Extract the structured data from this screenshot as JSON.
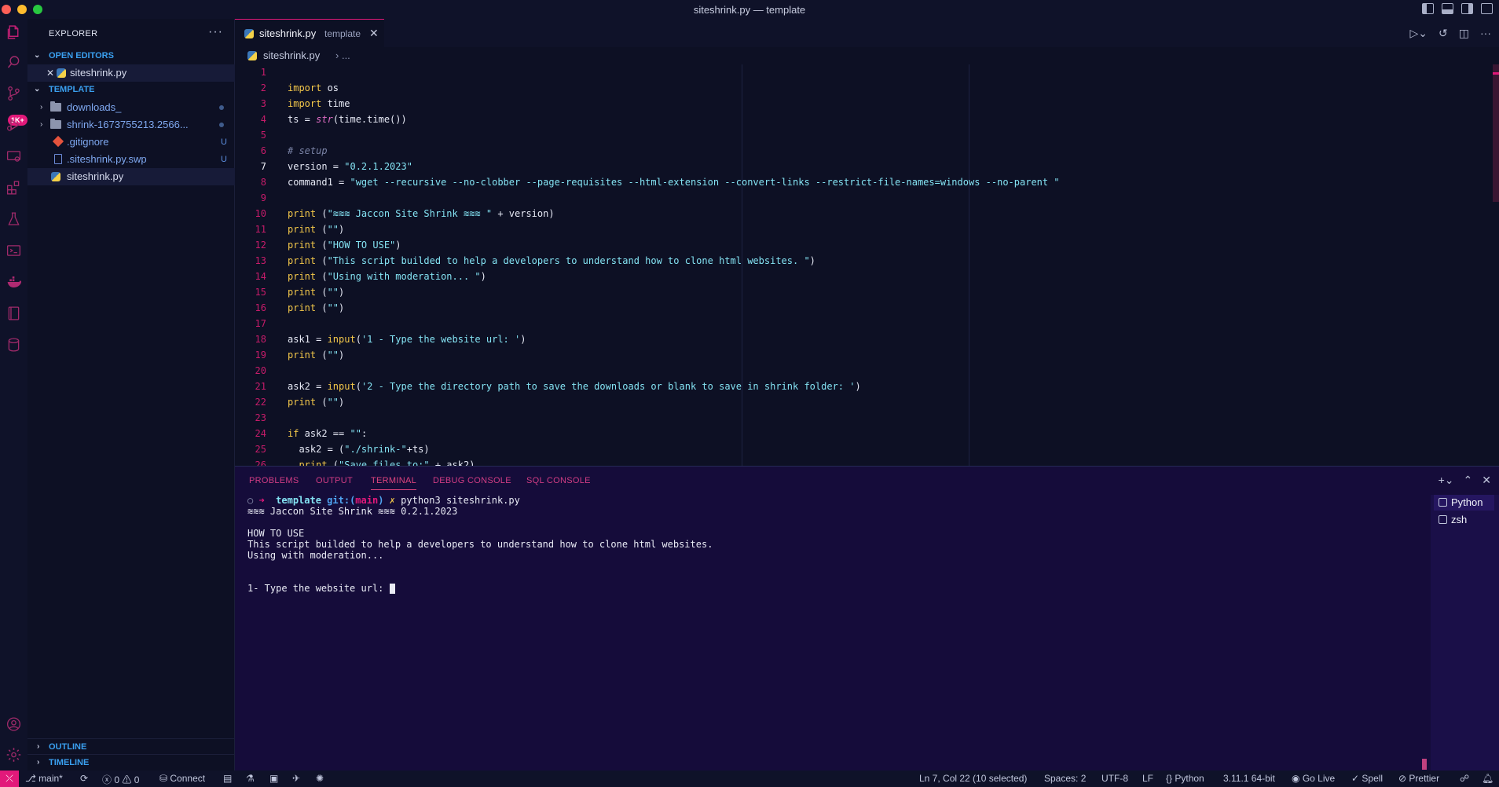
{
  "window": {
    "title": "siteshrink.py — template"
  },
  "activity": {
    "badge": "1K+"
  },
  "sidebar": {
    "title": "EXPLORER",
    "open_editors_label": "OPEN EDITORS",
    "open_editor_file": "siteshrink.py",
    "folder_label": "TEMPLATE",
    "items": [
      {
        "name": "downloads_",
        "type": "folder",
        "status": ""
      },
      {
        "name": "shrink-1673755213.2566...",
        "type": "folder",
        "status": ""
      },
      {
        "name": ".gitignore",
        "type": "git",
        "status": "U"
      },
      {
        "name": ".siteshrink.py.swp",
        "type": "file",
        "status": "U"
      },
      {
        "name": "siteshrink.py",
        "type": "python",
        "status": ""
      }
    ],
    "outline_label": "OUTLINE",
    "timeline_label": "TIMELINE"
  },
  "tabs": [
    {
      "name": "siteshrink.py",
      "description": "template"
    }
  ],
  "breadcrumb": {
    "file": "siteshrink.py",
    "rest": "..."
  },
  "editor": {
    "current_line": 7,
    "lines": [
      {
        "n": "1",
        "text": ""
      },
      {
        "n": "2",
        "text": "import os"
      },
      {
        "n": "3",
        "text": "import time"
      },
      {
        "n": "4",
        "text": "ts = str(time.time())"
      },
      {
        "n": "5",
        "text": ""
      },
      {
        "n": "6",
        "text": "# setup"
      },
      {
        "n": "7",
        "text": "version = \"0.2.1.2023\""
      },
      {
        "n": "8",
        "text": "command1 = \"wget --recursive --no-clobber --page-requisites --html-extension --convert-links --restrict-file-names=windows --no-parent \""
      },
      {
        "n": "9",
        "text": ""
      },
      {
        "n": "10",
        "text": "print (\"≋≋≋ Jaccon Site Shrink ≋≋≋ \" + version)"
      },
      {
        "n": "11",
        "text": "print (\"\")"
      },
      {
        "n": "12",
        "text": "print (\"HOW TO USE\")"
      },
      {
        "n": "13",
        "text": "print (\"This script builded to help a developers to understand how to clone html websites. \")"
      },
      {
        "n": "14",
        "text": "print (\"Using with moderation... \")"
      },
      {
        "n": "15",
        "text": "print (\"\")"
      },
      {
        "n": "16",
        "text": "print (\"\")"
      },
      {
        "n": "17",
        "text": ""
      },
      {
        "n": "18",
        "text": "ask1 = input('1 - Type the website url: ')"
      },
      {
        "n": "19",
        "text": "print (\"\")"
      },
      {
        "n": "20",
        "text": ""
      },
      {
        "n": "21",
        "text": "ask2 = input('2 - Type the directory path to save the downloads or blank to save in shrink folder: ')"
      },
      {
        "n": "22",
        "text": "print (\"\")"
      },
      {
        "n": "23",
        "text": ""
      },
      {
        "n": "24",
        "text": "if ask2 == \"\":"
      },
      {
        "n": "25",
        "text": "  ask2 = (\"./shrink-\"+ts)"
      },
      {
        "n": "26",
        "text": "  print (\"Save files to:\" + ask2)"
      }
    ]
  },
  "panel": {
    "tabs": [
      "PROBLEMS",
      "OUTPUT",
      "TERMINAL",
      "DEBUG CONSOLE",
      "SQL CONSOLE"
    ],
    "active_tab": "TERMINAL",
    "prompt": {
      "arrow": "➜",
      "dir": "template",
      "git": "git:(",
      "branch": "main",
      "git_close": ")",
      "mark": "✗",
      "command": "python3 siteshrink.py"
    },
    "output": [
      "≋≋≋ Jaccon Site Shrink ≋≋≋ 0.2.1.2023",
      "",
      "HOW TO USE",
      "This script builded to help a developers to understand how to clone html websites.",
      "Using with moderation...",
      "",
      ""
    ],
    "input_line": "1- Type the website url: ",
    "terminals": [
      "Python",
      "zsh"
    ]
  },
  "status": {
    "branch": "main*",
    "errors": "0",
    "warnings": "0",
    "connect": "Connect",
    "position": "Ln 7, Col 22 (10 selected)",
    "spaces": "Spaces: 2",
    "encoding": "UTF-8",
    "eol": "LF",
    "language": "Python",
    "interpreter": "3.11.1 64-bit",
    "golive": "Go Live",
    "spell": "Spell",
    "prettier": "Prettier"
  },
  "colors": {
    "accent": "#e2197a",
    "bg": "#0d1024",
    "panel": "#150c3a"
  }
}
